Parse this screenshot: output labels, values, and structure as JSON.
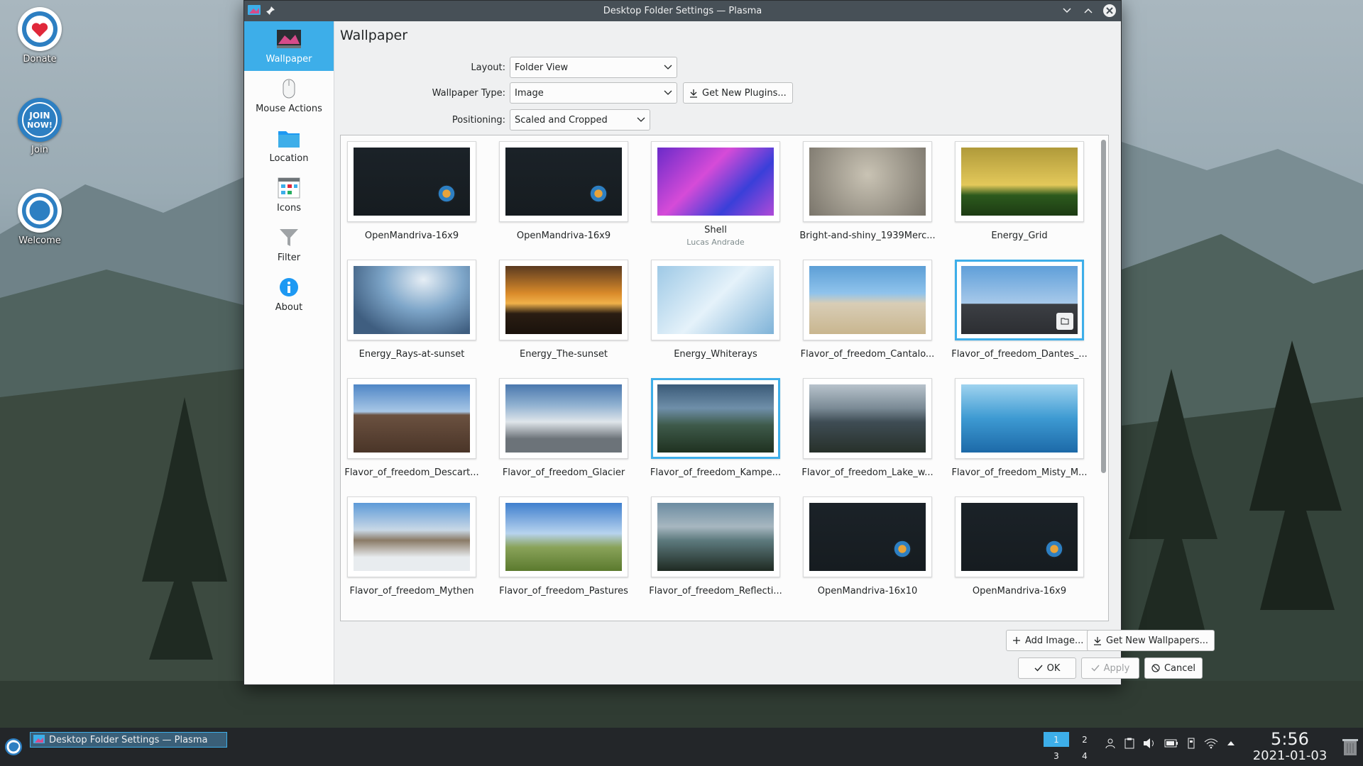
{
  "desktop": {
    "icons": [
      {
        "label": "Donate"
      },
      {
        "label": "Join"
      },
      {
        "label": "Welcome"
      }
    ]
  },
  "window": {
    "title": "Desktop Folder Settings — Plasma",
    "sidebar": [
      {
        "label": "Wallpaper",
        "icon": "monitor-icon"
      },
      {
        "label": "Mouse Actions",
        "icon": "mouse-icon"
      },
      {
        "label": "Location",
        "icon": "folder-icon"
      },
      {
        "label": "Icons",
        "icon": "icons-grid-icon"
      },
      {
        "label": "Filter",
        "icon": "filter-icon"
      },
      {
        "label": "About",
        "icon": "info-icon"
      }
    ],
    "page_title": "Wallpaper",
    "layout": {
      "label": "Layout:",
      "value": "Folder View"
    },
    "wallpaper_type": {
      "label": "Wallpaper Type:",
      "value": "Image"
    },
    "get_plugins": "Get New Plugins...",
    "positioning": {
      "label": "Positioning:",
      "value": "Scaled and Cropped"
    },
    "wallpapers": [
      {
        "name": "OpenMandriva-16x9",
        "sub": ""
      },
      {
        "name": "OpenMandriva-16x9",
        "sub": ""
      },
      {
        "name": "Shell",
        "sub": "Lucas Andrade"
      },
      {
        "name": "Bright-and-shiny_1939Merc...",
        "sub": ""
      },
      {
        "name": "Energy_Grid",
        "sub": ""
      },
      {
        "name": "Energy_Rays-at-sunset",
        "sub": ""
      },
      {
        "name": "Energy_The-sunset",
        "sub": ""
      },
      {
        "name": "Energy_Whiterays",
        "sub": ""
      },
      {
        "name": "Flavor_of_freedom_Cantalo...",
        "sub": ""
      },
      {
        "name": "Flavor_of_freedom_Dantes_...",
        "sub": ""
      },
      {
        "name": "Flavor_of_freedom_Descart...",
        "sub": ""
      },
      {
        "name": "Flavor_of_freedom_Glacier",
        "sub": ""
      },
      {
        "name": "Flavor_of_freedom_Kampe...",
        "sub": ""
      },
      {
        "name": "Flavor_of_freedom_Lake_w...",
        "sub": ""
      },
      {
        "name": "Flavor_of_freedom_Misty_M...",
        "sub": ""
      },
      {
        "name": "Flavor_of_freedom_Mythen",
        "sub": ""
      },
      {
        "name": "Flavor_of_freedom_Pastures",
        "sub": ""
      },
      {
        "name": "Flavor_of_freedom_Reflecti...",
        "sub": ""
      },
      {
        "name": "OpenMandriva-16x10",
        "sub": ""
      },
      {
        "name": "OpenMandriva-16x9",
        "sub": ""
      }
    ],
    "selected_index": 12,
    "hovered_index": 9,
    "buttons": {
      "add_image": "Add Image...",
      "get_wallpapers": "Get New Wallpapers...",
      "ok": "OK",
      "apply": "Apply",
      "cancel": "Cancel"
    }
  },
  "taskbar": {
    "task_title": "Desktop Folder Settings — Plasma",
    "pager": [
      "1",
      "2",
      "3",
      "4"
    ],
    "active_desktop": "1",
    "time": "5:56",
    "date": "2021-01-03"
  },
  "colors": {
    "accent": "#3daee9",
    "titlebar": "#475057",
    "taskbar": "#232629"
  }
}
